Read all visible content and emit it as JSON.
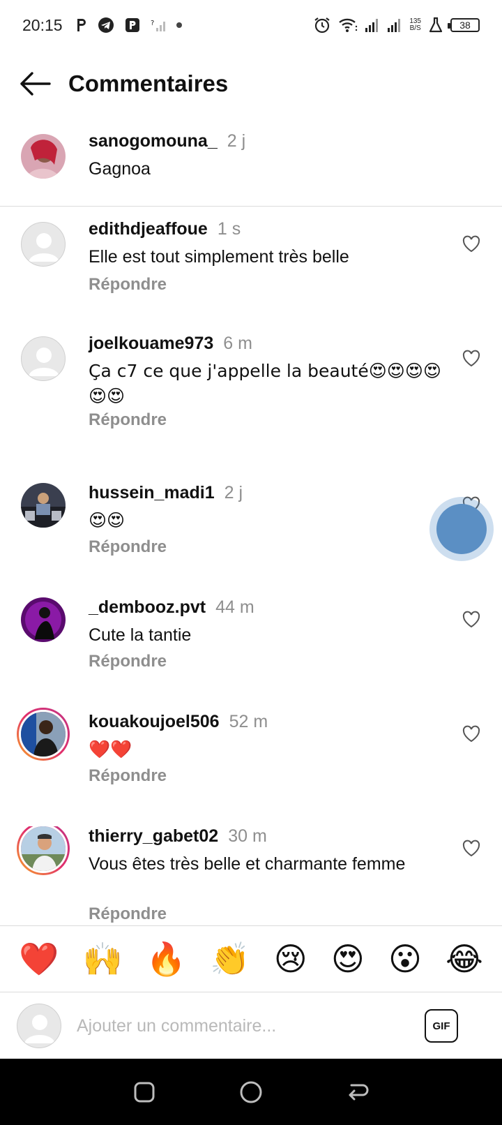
{
  "status_bar": {
    "time": "20:15",
    "speed_top": "135",
    "speed_bottom": "B/S",
    "battery": "38",
    "icons": [
      "p-icon",
      "telegram-icon",
      "p-box-icon",
      "no-signal-icon",
      "dot-icon",
      "alarm-icon",
      "wifi-icon",
      "signal-icon",
      "signal-icon-2",
      "lab-icon",
      "battery-icon"
    ]
  },
  "header": {
    "title": "Commentaires"
  },
  "caption": {
    "username": "sanogomouna_",
    "time": "2 j",
    "text": "Gagnoa"
  },
  "reply_label": "Répondre",
  "comments": [
    {
      "username": "edithdjeaffoue",
      "time": "1 s",
      "text": "Elle est tout simplement très belle"
    },
    {
      "username": "joelkouame973",
      "time": "6 m",
      "text": "Ça c7 ce que j'appelle la beauté😍😍😍😍😍😍"
    },
    {
      "username": "hussein_madi1",
      "time": "2 j",
      "text": "😍😍"
    },
    {
      "username": "_dembooz.pvt",
      "time": "44 m",
      "text": "Cute la tantie"
    },
    {
      "username": "kouakoujoel506",
      "time": "52 m",
      "text": "❤️❤️"
    },
    {
      "username": "thierry_gabet02",
      "time": "30 m",
      "text": "Vous êtes très belle et charmante femme"
    }
  ],
  "emoji_bar": [
    "❤️",
    "🙌",
    "🔥",
    "👏",
    "😢",
    "😍",
    "😮",
    "😂"
  ],
  "input": {
    "placeholder": "Ajouter un commentaire...",
    "gif_label": "GIF"
  },
  "colors": {
    "secondary_text": "#8e8e8e",
    "divider": "#dbdbdb",
    "nav_bar": "#000000"
  }
}
